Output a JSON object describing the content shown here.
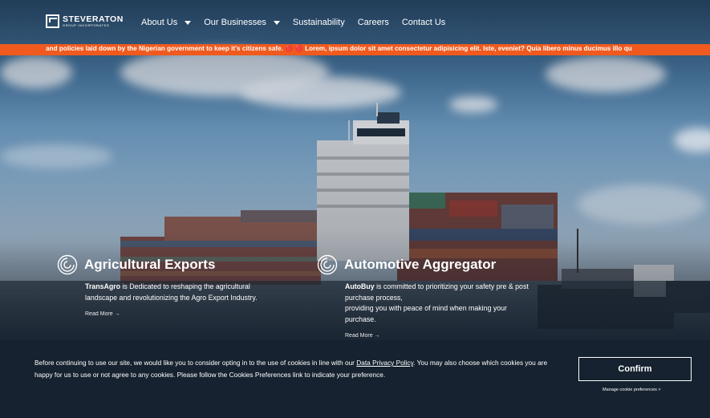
{
  "brand": {
    "name": "STEVERATON",
    "sub": "GROUP INCORPORATED",
    "logo_icon": "s-logo-icon"
  },
  "nav": {
    "items": [
      {
        "label": "About Us",
        "dropdown": true
      },
      {
        "label": "Our Businesses",
        "dropdown": true
      },
      {
        "label": "Sustainability",
        "dropdown": false
      },
      {
        "label": "Careers",
        "dropdown": false
      },
      {
        "label": "Contact Us",
        "dropdown": false
      }
    ]
  },
  "ticker": {
    "text": "and policies laid down by the Nigerian government to keep it's citizens safe. 🔴 🔴 Lorem, ipsum dolor sit amet consectetur adipisicing elit. Iste, eveniet? Quia libero minus ducimus illo qu"
  },
  "cards": [
    {
      "title": "Agricultural Exports",
      "brand": "TransAgro",
      "body": " is Dedicated to reshaping the agricultural landscape and revolutionizing the Agro Export Industry.",
      "read_more": "Read More →"
    },
    {
      "title": "Automotive Aggregator",
      "brand": "AutoBuy",
      "body1": " is committed to prioritizing your safety pre & post purchase process,",
      "body2": "providing you with peace of mind when making your purchase.",
      "read_more": "Read More →"
    }
  ],
  "cookie": {
    "text_before": "Before continuing to use our site, we would like you to consider opting in to the use of cookies in line with our ",
    "link": "Data Privacy Policy",
    "text_after": ". You may also choose which cookies you are happy for us to use or not agree to any cookies. Please follow the Cookies Preferences link to indicate your preference.",
    "confirm_label": "Confirm",
    "manage_label": "Manage cookie preferences >"
  },
  "colors": {
    "accent": "#f05a1e",
    "cookie_bg": "#16222f"
  }
}
